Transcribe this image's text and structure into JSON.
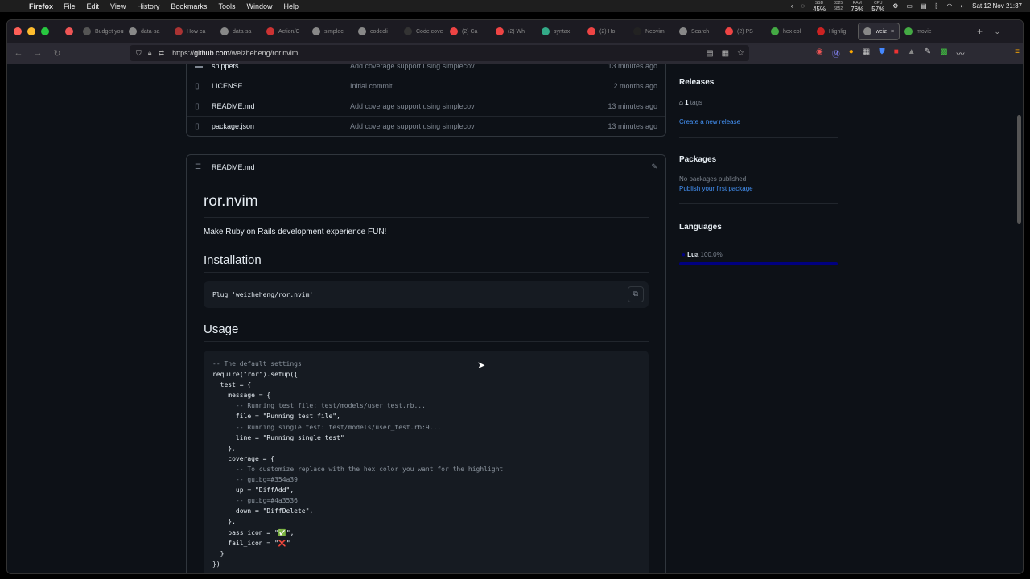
{
  "menubar": {
    "app": "Firefox",
    "menus": [
      "File",
      "Edit",
      "View",
      "History",
      "Bookmarks",
      "Tools",
      "Window",
      "Help"
    ],
    "stats": [
      {
        "top": "SSD",
        "bottom": "45%"
      },
      {
        "top": "8325",
        "bottom": "6852"
      },
      {
        "top": "RAM",
        "bottom": "76%"
      },
      {
        "top": "CPU",
        "bottom": "57%"
      }
    ],
    "clock": "Sat 12 Nov  21:37"
  },
  "tabs": [
    {
      "label": "Budget your",
      "color": "#555"
    },
    {
      "label": "data-sa",
      "color": "#888"
    },
    {
      "label": "How ca",
      "color": "#a33"
    },
    {
      "label": "data-sa",
      "color": "#888"
    },
    {
      "label": "Action/C",
      "color": "#c33"
    },
    {
      "label": "simplec",
      "color": "#888"
    },
    {
      "label": "codecli",
      "color": "#888"
    },
    {
      "label": "Code cove",
      "color": "#333"
    },
    {
      "label": "(2) Ca",
      "color": "#e44"
    },
    {
      "label": "(2) Wh",
      "color": "#e44"
    },
    {
      "label": "syntax",
      "color": "#3a8"
    },
    {
      "label": "(2) Ho",
      "color": "#e44"
    },
    {
      "label": "Neovim",
      "color": "#222"
    },
    {
      "label": "Search",
      "color": "#888"
    },
    {
      "label": "(2) PS",
      "color": "#e44"
    },
    {
      "label": "hex col",
      "color": "#4a4"
    },
    {
      "label": "Highlig",
      "color": "#c22"
    },
    {
      "label": "weiz",
      "color": "#888",
      "active": true
    },
    {
      "label": "movie",
      "color": "#4a4"
    }
  ],
  "url": {
    "scheme": "https://",
    "host": "github.com",
    "path": "/weizheheng/ror.nvim"
  },
  "files": [
    {
      "icon": "folder",
      "name": "snippets",
      "message": "Add coverage support using simplecov",
      "time": "13 minutes ago"
    },
    {
      "icon": "file",
      "name": "LICENSE",
      "message": "Initial commit",
      "time": "2 months ago"
    },
    {
      "icon": "file",
      "name": "README.md",
      "message": "Add coverage support using simplecov",
      "time": "13 minutes ago"
    },
    {
      "icon": "file",
      "name": "package.json",
      "message": "Add coverage support using simplecov",
      "time": "13 minutes ago"
    }
  ],
  "readme": {
    "filename": "README.md",
    "title": "ror.nvim",
    "tagline": "Make Ruby on Rails development experience FUN!",
    "install_heading": "Installation",
    "install_code": "Plug 'weizheheng/ror.nvim'",
    "usage_heading": "Usage",
    "usage_code": [
      {
        "text": "-- The default settings",
        "cls": "cm"
      },
      {
        "text": "require(\"ror\").setup({",
        "cls": ""
      },
      {
        "text": "  test = {",
        "cls": ""
      },
      {
        "text": "    message = {",
        "cls": ""
      },
      {
        "text": "      -- Running test file: test/models/user_test.rb...",
        "cls": "cm"
      },
      {
        "text": "      file = \"Running test file\",",
        "cls": ""
      },
      {
        "text": "      -- Running single test: test/models/user_test.rb:9...",
        "cls": "cm"
      },
      {
        "text": "      line = \"Running single test\"",
        "cls": ""
      },
      {
        "text": "    },",
        "cls": ""
      },
      {
        "text": "    coverage = {",
        "cls": ""
      },
      {
        "text": "      -- To customize replace with the hex color you want for the highlight",
        "cls": "cm"
      },
      {
        "text": "      -- guibg=#354a39",
        "cls": "cm"
      },
      {
        "text": "      up = \"DiffAdd\",",
        "cls": ""
      },
      {
        "text": "      -- guibg=#4a3536",
        "cls": "cm"
      },
      {
        "text": "      down = \"DiffDelete\",",
        "cls": ""
      },
      {
        "text": "    },",
        "cls": ""
      },
      {
        "text": "    pass_icon = \"✅\",",
        "cls": ""
      },
      {
        "text": "    fail_icon = \"❌\"",
        "cls": ""
      },
      {
        "text": "  }",
        "cls": ""
      },
      {
        "text": "})",
        "cls": ""
      }
    ]
  },
  "sidebar": {
    "releases_heading": "Releases",
    "tags_count": "1",
    "tags_label": "tags",
    "create_release": "Create a new release",
    "packages_heading": "Packages",
    "no_packages": "No packages published",
    "publish_package": "Publish your first package",
    "languages_heading": "Languages",
    "language_name": "Lua",
    "language_percent": "100.0%",
    "language_color": "#000080"
  }
}
